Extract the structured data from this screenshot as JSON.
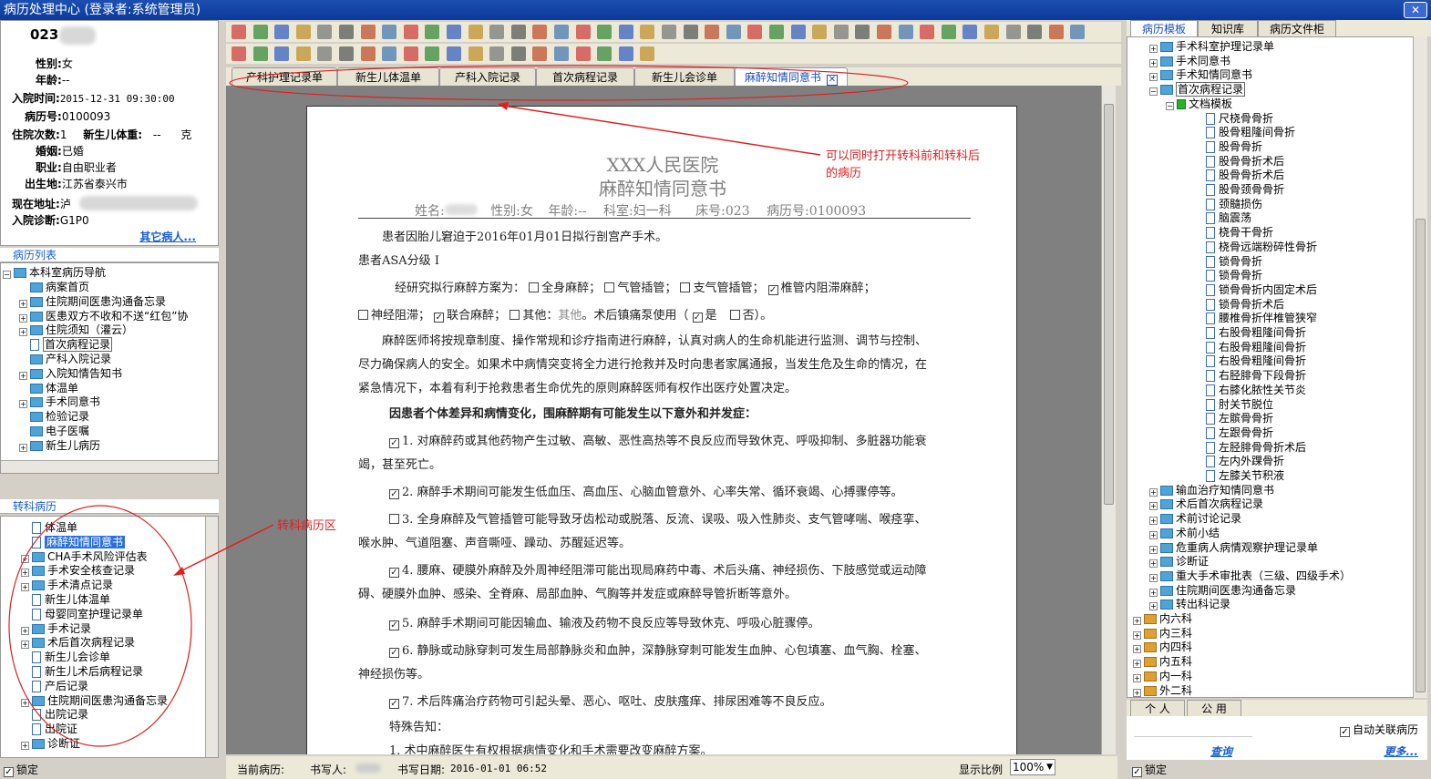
{
  "window": {
    "title": "病历处理中心   (登录者:系统管理员)",
    "close_label": "✕"
  },
  "patient": {
    "bed": "023",
    "gender_label": "性别:",
    "gender": "女",
    "age_label": "年龄:",
    "age": "--",
    "admit_time_label": "入院时间:",
    "admit_time": "2015-12-31 09:30:00",
    "record_no_label": "病历号:",
    "record_no": "0100093",
    "visits_label": "住院次数:",
    "visits": "1",
    "newborn_weight_label": "新生儿体重:",
    "newborn_weight": "--",
    "weight_unit": "克",
    "marital_label": "婚姻:",
    "marital": "已婚",
    "job_label": "职业:",
    "job": "自由职业者",
    "birthplace_label": "出生地:",
    "birthplace": "江苏省泰兴市",
    "address_label": "现在地址:",
    "address": "泸",
    "diagnosis_label": "入院诊断:",
    "diagnosis": "G1P0",
    "other_patient": "其它病人..."
  },
  "doc_list": {
    "header": "病历列表",
    "root": "本科室病历导航",
    "items": [
      {
        "label": "病案首页",
        "expand": ""
      },
      {
        "label": "住院期间医患沟通备忘录",
        "expand": "+"
      },
      {
        "label": "医患双方不收和不送“红包”协",
        "expand": "+"
      },
      {
        "label": "住院须知（灌云）",
        "expand": "+"
      },
      {
        "label": "首次病程记录",
        "expand": ""
      },
      {
        "label": "产科入院记录",
        "expand": ""
      },
      {
        "label": "入院知情告知书",
        "expand": "+"
      },
      {
        "label": "体温单",
        "expand": ""
      },
      {
        "label": "手术同意书",
        "expand": "+"
      },
      {
        "label": "检验记录",
        "expand": ""
      },
      {
        "label": "电子医嘱",
        "expand": ""
      },
      {
        "label": "新生儿病历",
        "expand": "+"
      }
    ]
  },
  "transfer_list": {
    "header": "转科病历",
    "items": [
      {
        "label": "体温单",
        "expand": ""
      },
      {
        "label": "麻醉知情同意书",
        "expand": "",
        "selected": true
      },
      {
        "label": "CHA手术风险评估表",
        "expand": "+"
      },
      {
        "label": "手术安全核查记录",
        "expand": "+"
      },
      {
        "label": "手术清点记录",
        "expand": "+"
      },
      {
        "label": "新生儿体温单",
        "expand": ""
      },
      {
        "label": "母婴同室护理记录单",
        "expand": ""
      },
      {
        "label": "手术记录",
        "expand": "+"
      },
      {
        "label": "术后首次病程记录",
        "expand": "+"
      },
      {
        "label": "新生儿会诊单",
        "expand": ""
      },
      {
        "label": "新生儿术后病程记录",
        "expand": ""
      },
      {
        "label": "产后记录",
        "expand": ""
      },
      {
        "label": "住院期间医患沟通备忘录",
        "expand": "+"
      },
      {
        "label": "出院记录",
        "expand": ""
      },
      {
        "label": "出院证",
        "expand": ""
      },
      {
        "label": "诊断证",
        "expand": "+"
      }
    ]
  },
  "lock_label": "锁定",
  "tabs": [
    {
      "label": "产科护理记录单"
    },
    {
      "label": "新生儿体温单"
    },
    {
      "label": "产科入院记录"
    },
    {
      "label": "首次病程记录"
    },
    {
      "label": "新生儿会诊单"
    },
    {
      "label": "麻醉知情同意书",
      "active": true
    }
  ],
  "tab_close": "✕",
  "document": {
    "hospital": "XXX人民医院",
    "title": "麻醉知情同意书",
    "name_label": "姓名:",
    "name": "",
    "gender_label": "性别:",
    "gender": "女",
    "age_label": "年龄:",
    "age": "--",
    "dept_label": "科室:",
    "dept": "妇一科",
    "bed_label": "床号:",
    "bed": "023",
    "record_label": "病历号:",
    "record": "0100093",
    "p1": "患者因胎儿窘迫于2016年01月01日拟行剖宫产手术。",
    "p2": "患者ASA分级  Ⅰ",
    "plan_intro": "经研究拟行麻醉方案为：",
    "opt_general": "全身麻醉",
    "opt_tube": "气管插管",
    "opt_bronch": "支气管插管",
    "opt_spinal": "椎管内阻滞麻醉",
    "opt_nerve": "神经阻滞",
    "opt_combined": "联合麻醉",
    "opt_other_label": "其他：",
    "opt_other": "其他",
    "analgesia": "。术后镇痛泵使用（",
    "yes": "是",
    "no": "否）。",
    "para1a": "麻醉医师将按规章制度、操作常规和诊疗指南进行麻醉，认真对病人的生命机能进行监测、调节与控制、",
    "para1b": "尽力确保病人的安全。如果术中病情突变将全力进行抢救并及时向患者家属通报，当发生危及生命的情况，在",
    "para1c": "紧急情况下，本着有利于抢救患者生命优先的原则麻醉医师有权作出医疗处置决定。",
    "risk_head": "因患者个体差异和病情变化，围麻醉期有可能发生以下意外和并发症：",
    "r1a": "1. 对麻醉药或其他药物产生过敏、高敏、恶性高热等不良反应而导致休克、呼吸抑制、多脏器功能衰",
    "r1b": "竭，甚至死亡。",
    "r2": "2. 麻醉手术期间可能发生低血压、高血压、心脑血管意外、心率失常、循环衰竭、心搏骤停等。",
    "r3a": "3. 全身麻醉及气管插管可能导致牙齿松动或脱落、反流、误吸、吸入性肺炎、支气管哮喘、喉痉挛、",
    "r3b": "喉水肿、气道阻塞、声音嘶哑、躁动、苏醒延迟等。",
    "r4a": "4. 腰麻、硬膜外麻醉及外周神经阻滞可能出现局麻药中毒、术后头痛、神经损伤、下肢感觉或运动障",
    "r4b": "碍、硬膜外血肿、感染、全脊麻、局部血肿、气胸等并发症或麻醉导管折断等意外。",
    "r5": "5. 麻醉手术期间可能因输血、输液及药物不良反应等导致休克、呼吸心脏骤停。",
    "r6a": "6. 静脉或动脉穿刺可发生局部静脉炎和血肿，深静脉穿刺可能发生血肿、心包填塞、血气胸、栓塞、",
    "r6b": "神经损伤等。",
    "r7": "7. 术后阵痛治疗药物可引起头晕、恶心、呕吐、皮肤瘙痒、排尿困难等不良反应。",
    "special": "特殊告知：",
    "s1": "1. 术中麻醉医生有权根据病情变化和手术需要改变麻醉方案。"
  },
  "status": {
    "current_label": "当前病历:",
    "writer_label": "书写人:",
    "date_label": "书写日期:",
    "date": "2016-01-01 06:52",
    "zoom_label": "显示比例",
    "zoom": "100%"
  },
  "right_tabs": [
    {
      "label": "病历模板",
      "active": true
    },
    {
      "label": "知识库"
    },
    {
      "label": "病历文件柜"
    }
  ],
  "template_tree": {
    "top": [
      {
        "label": "手术科室护理记录单"
      },
      {
        "label": "手术同意书"
      },
      {
        "label": "手术知情同意书"
      },
      {
        "label": "首次病程记录",
        "open": true
      }
    ],
    "sub_folder": "文档模板",
    "leaves": [
      "尺桡骨骨折",
      "股骨粗隆间骨折",
      "股骨骨折",
      "股骨骨折术后",
      "股骨骨折术后",
      "股骨颈骨骨折",
      "颈髓损伤",
      "脑震荡",
      "桡骨干骨折",
      "桡骨远端粉碎性骨折",
      "锁骨骨折",
      "锁骨骨折",
      "锁骨骨折内固定术后",
      "锁骨骨折术后",
      "腰椎骨折伴椎管狭窄",
      "右股骨粗隆间骨折",
      "右股骨粗隆间骨折",
      "右股骨粗隆间骨折",
      "右胫腓骨下段骨折",
      "右膝化脓性关节炎",
      "肘关节脱位",
      "左髌骨骨折",
      "左跟骨骨折",
      "左胫腓骨骨折术后",
      "左内外踝骨折",
      "左膝关节积液"
    ],
    "bottom": [
      {
        "label": "输血治疗知情同意书"
      },
      {
        "label": "术后首次病程记录"
      },
      {
        "label": "术前讨论记录"
      },
      {
        "label": "术前小结"
      },
      {
        "label": "危重病人病情观察护理记录单"
      },
      {
        "label": "诊断证"
      },
      {
        "label": "重大手术审批表（三级、四级手术）"
      },
      {
        "label": "住院期间医患沟通备忘录"
      },
      {
        "label": "转出科记录"
      }
    ],
    "depts": [
      "内六科",
      "内三科",
      "内四科",
      "内五科",
      "内一科",
      "外二科"
    ]
  },
  "scope_tabs": [
    {
      "label": "个 人"
    },
    {
      "label": "公 用"
    }
  ],
  "auto_link": "自动关联病历",
  "search": "查询",
  "more": "更多...",
  "annotations": {
    "a1_line1": "可以同时打开转科前和转科后",
    "a1_line2": "的病历",
    "a2": "转科病历区"
  },
  "colors": {
    "accent": "#1a5fd0",
    "annotation": "#e02020",
    "title_bar": "#0a3a9c",
    "selection": "#2a6fe0"
  }
}
